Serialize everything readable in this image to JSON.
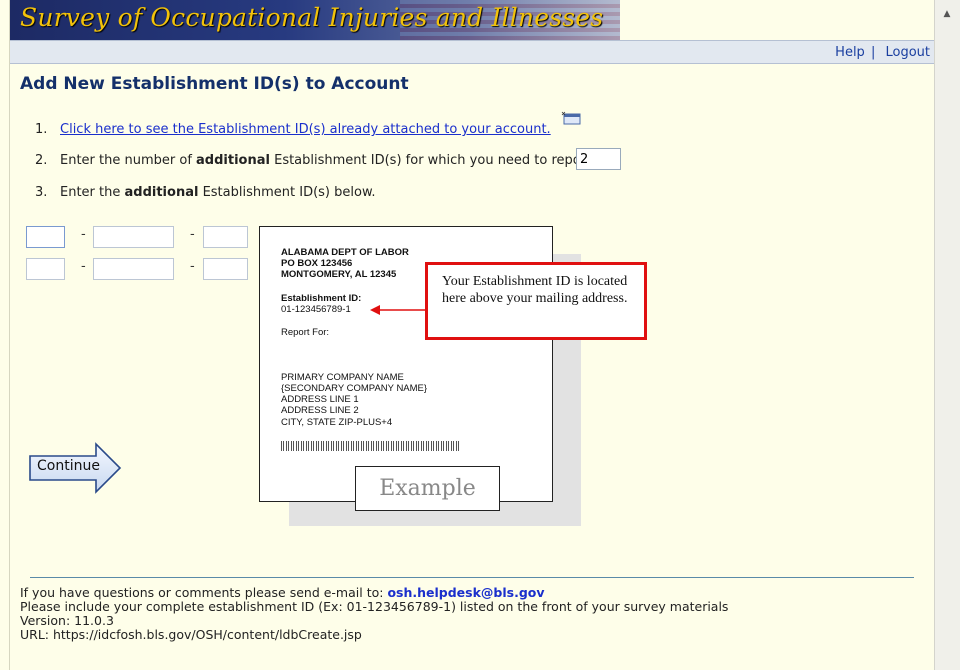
{
  "banner": {
    "title": "Survey of Occupational Injuries and Illnesses"
  },
  "topbar": {
    "help_label": "Help",
    "separator": "|",
    "logout_label": "Logout"
  },
  "page": {
    "title": "Add New Establishment ID(s) to Account"
  },
  "steps": {
    "step1": {
      "number": "1.",
      "link_text": "Click here to see the Establishment ID(s) already attached to your account."
    },
    "step2": {
      "number": "2.",
      "text_before": "Enter the number of ",
      "bold": "additional",
      "text_after": " Establishment ID(s) for which you need to report."
    },
    "step3": {
      "number": "3.",
      "text_before": "Enter the ",
      "bold": "additional",
      "text_after": " Establishment ID(s) below."
    }
  },
  "count_input": {
    "value": "2"
  },
  "id_rows": [
    {
      "part1": "",
      "part2": "",
      "part3": ""
    },
    {
      "part1": "",
      "part2": "",
      "part3": ""
    }
  ],
  "dash": "-",
  "example_card": {
    "line1": "ALABAMA DEPT OF LABOR",
    "line2": "PO BOX 123456",
    "line3": "MONTGOMERY, AL 12345",
    "id_label": "Establishment ID:",
    "id_value": "01-123456789-1",
    "report_for": "Report For:",
    "company1": "PRIMARY COMPANY NAME",
    "company2": "{SECONDARY COMPANY NAME}",
    "addr1": "ADDRESS LINE 1",
    "addr2": "ADDRESS LINE 2",
    "city": "CITY, STATE  ZIP-PLUS+4",
    "tab_label": "Example"
  },
  "callout": {
    "text": "Your Establishment ID is located here above your mailing address."
  },
  "continue_button": {
    "label": "Continue"
  },
  "footer": {
    "line1_prefix": "If you have questions or comments please send e-mail to: ",
    "email": "osh.helpdesk@bls.gov",
    "line2": "Please include your complete establishment ID (Ex: 01-123456789-1) listed on the front of your survey materials",
    "version": "Version: 11.0.3",
    "url": "URL: https://idcfosh.bls.gov/OSH/content/ldbCreate.jsp"
  },
  "colors": {
    "accent": "#14306a",
    "link": "#1a2fcc",
    "callout_border": "#e01010",
    "banner_text": "#f2c20a"
  }
}
